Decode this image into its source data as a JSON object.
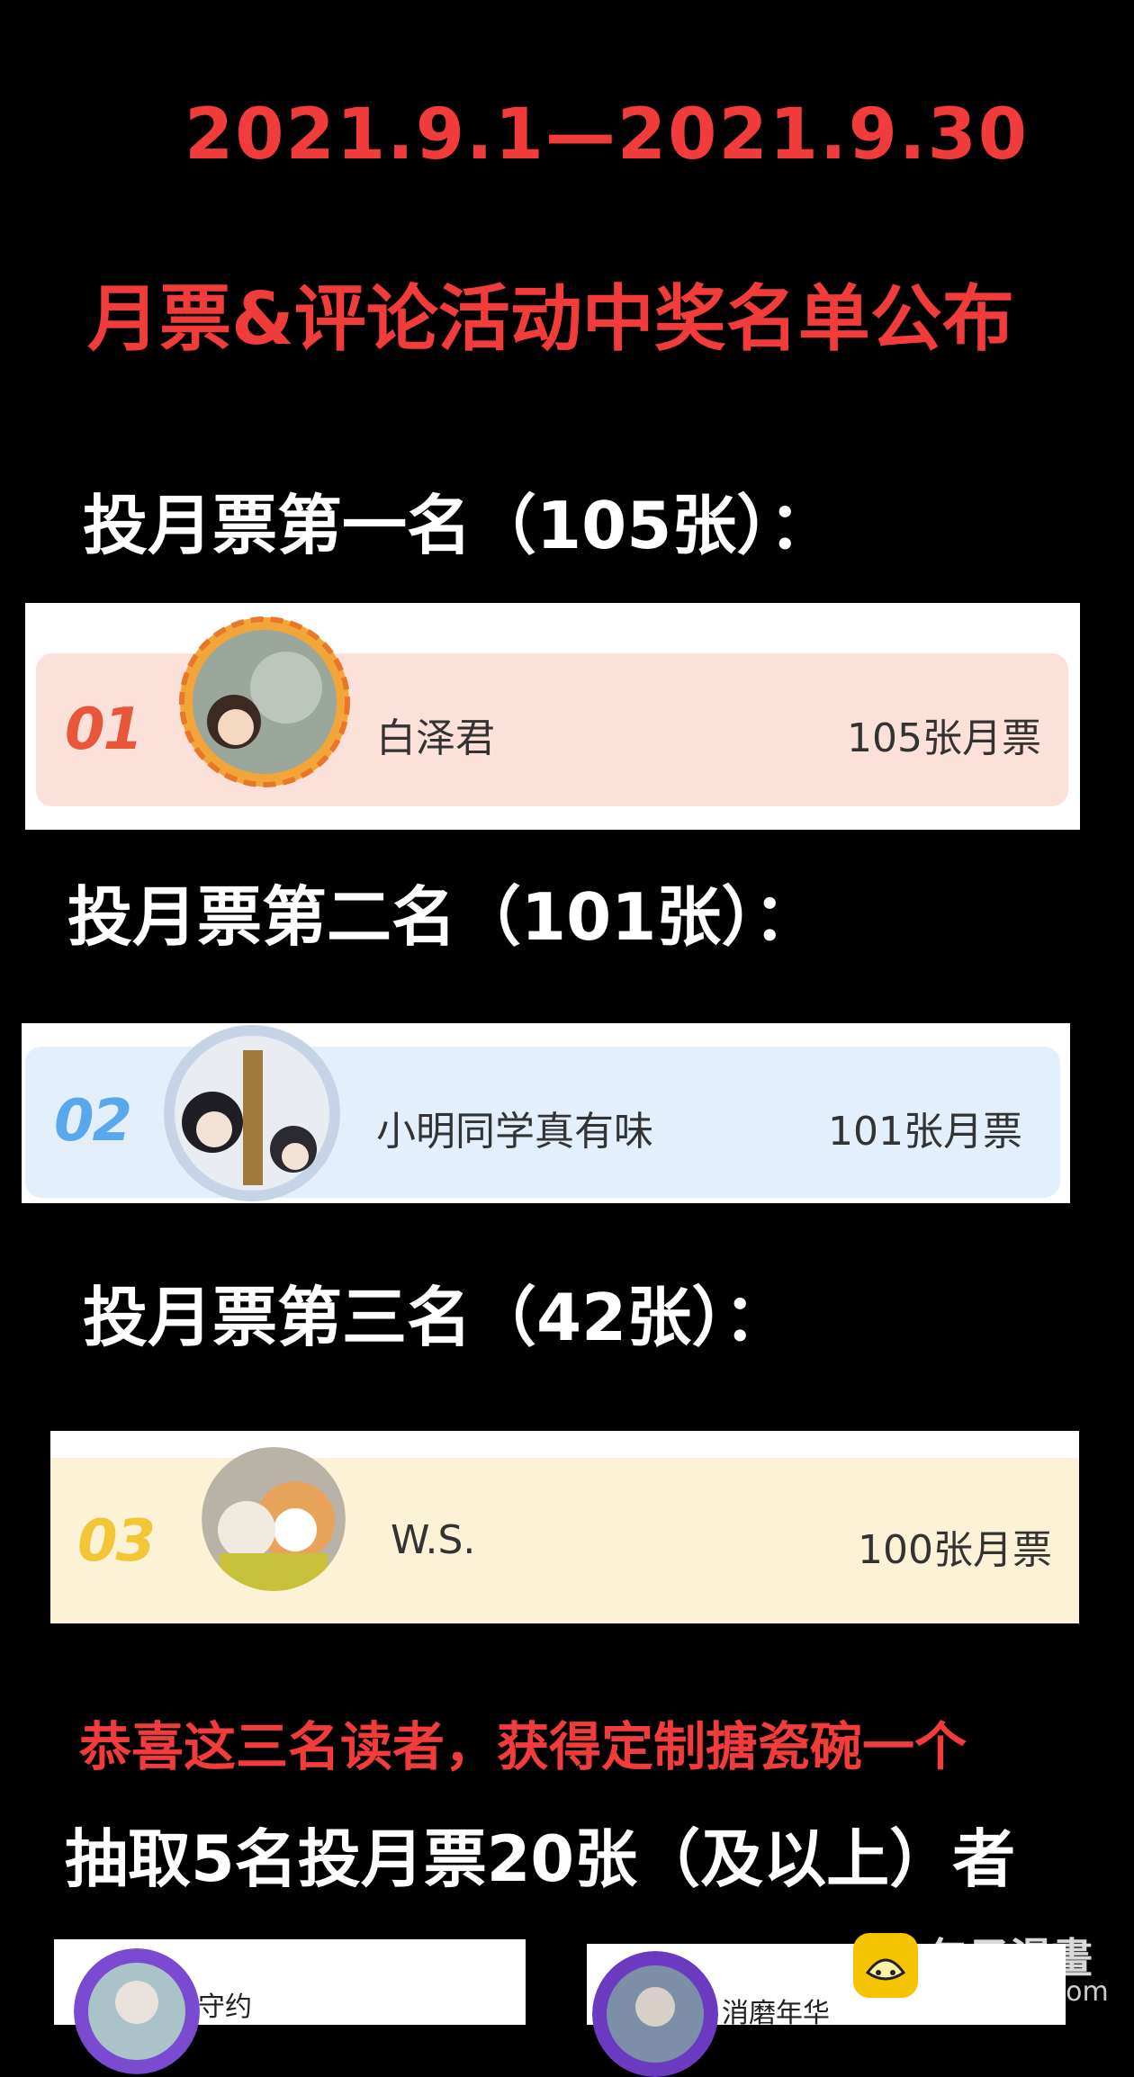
{
  "header": {
    "date_range": "2021.9.1—2021.9.30",
    "title": "月票&评论活动中奖名单公布"
  },
  "sections": [
    {
      "heading": "投月票第一名（105张）：",
      "rank": "01",
      "name": "白泽君",
      "votes": "105张月票",
      "card_bg": "#fbe1d9",
      "rank_color": "#e8573a"
    },
    {
      "heading": "投月票第二名（101张）：",
      "rank": "02",
      "name": "小明同学真有味",
      "votes": "101张月票",
      "card_bg": "#e3effb",
      "rank_color": "#5aa8ec"
    },
    {
      "heading": "投月票第三名（42张）：",
      "rank": "03",
      "name": "W.S.",
      "votes": "100张月票",
      "card_bg": "#fcf3d7",
      "rank_color": "#f2c636"
    }
  ],
  "congrats": "恭喜这三名读者，获得定制搪瓷碗一个",
  "draw_heading": "抽取5名投月票20张（及以上）者",
  "draw_winners": [
    {
      "name": "守约"
    },
    {
      "name": "消磨年华"
    }
  ],
  "watermark": {
    "brand": "包子漫畫",
    "url": "baozimh.com"
  }
}
